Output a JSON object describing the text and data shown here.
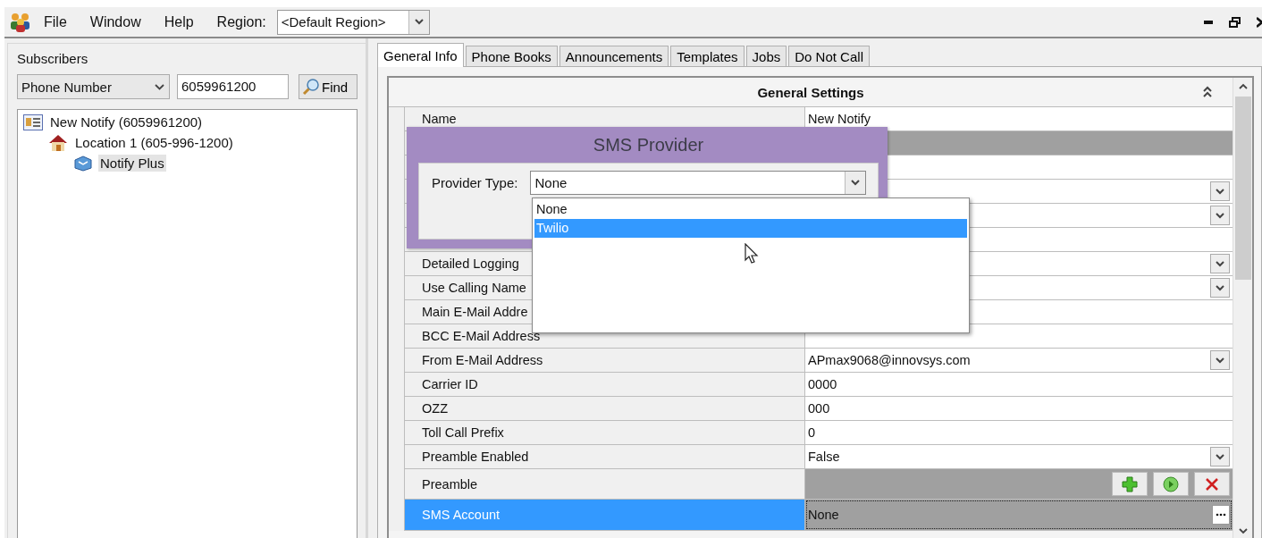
{
  "menu": {
    "items": [
      "File",
      "Window",
      "Help"
    ],
    "region_label": "Region:",
    "region_value": "<Default Region>"
  },
  "subscribers": {
    "title": "Subscribers",
    "search_by": "Phone Number",
    "search_value": "6059961200",
    "find_button": "Find",
    "tree": [
      {
        "label": "New Notify (6059961200)",
        "kind": "contact",
        "selected": false,
        "children": [
          {
            "label": "Location 1 (605-996-1200)",
            "kind": "house",
            "selected": false,
            "children": [
              {
                "label": "Notify Plus",
                "kind": "package",
                "selected": true
              }
            ]
          }
        ]
      }
    ]
  },
  "tabs": [
    {
      "label": "General Info",
      "selected": true
    },
    {
      "label": "Phone Books",
      "selected": false
    },
    {
      "label": "Announcements",
      "selected": false
    },
    {
      "label": "Templates",
      "selected": false
    },
    {
      "label": "Jobs",
      "selected": false
    },
    {
      "label": "Do Not Call",
      "selected": false
    }
  ],
  "settings": {
    "title": "General Settings",
    "rows": [
      {
        "label": "Name",
        "value": "New Notify",
        "kind": "text",
        "selected": false
      },
      {
        "kind": "shaded",
        "selected": false
      },
      {
        "kind": "text",
        "selected": false
      },
      {
        "kind": "dropdown",
        "selected": false
      },
      {
        "kind": "dropdown",
        "selected": false
      },
      {
        "kind": "text",
        "selected": false
      },
      {
        "label": "Detailed Logging",
        "kind": "dropdown",
        "selected": false
      },
      {
        "label": "Use Calling Name",
        "kind": "dropdown",
        "selected": false
      },
      {
        "label": "Main E-Mail Addre",
        "kind": "text",
        "selected": false
      },
      {
        "label": "BCC E-Mail Address",
        "kind": "text",
        "selected": false
      },
      {
        "label": "From E-Mail Address",
        "value": "APmax9068@innovsys.com",
        "kind": "dropdown",
        "selected": false
      },
      {
        "label": "Carrier ID",
        "value": "0000",
        "kind": "text",
        "selected": false
      },
      {
        "label": "OZZ",
        "value": "000",
        "kind": "text",
        "selected": false
      },
      {
        "label": "Toll Call Prefix",
        "value": "0",
        "kind": "text",
        "selected": false
      },
      {
        "label": "Preamble Enabled",
        "value": "False",
        "kind": "dropdown",
        "selected": false
      },
      {
        "label": "Preamble",
        "kind": "actions",
        "selected": false
      },
      {
        "label": "SMS Account",
        "value": "None",
        "kind": "ellipsis",
        "selected": true
      }
    ]
  },
  "dialog": {
    "title": "SMS Provider",
    "field_label": "Provider Type:",
    "field_value": "None",
    "options": [
      {
        "label": "None",
        "selected": false
      },
      {
        "label": "Twilio",
        "selected": true
      }
    ]
  }
}
